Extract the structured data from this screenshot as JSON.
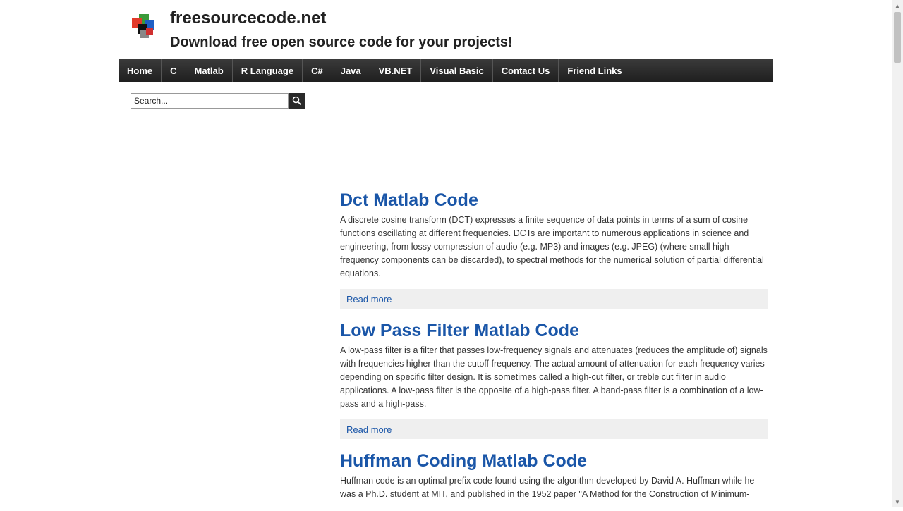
{
  "header": {
    "title": "freesourcecode.net",
    "tagline": "Download free open source code for your projects!"
  },
  "nav": {
    "items": [
      "Home",
      "C",
      "Matlab",
      "R Language",
      "C#",
      "Java",
      "VB.NET",
      "Visual Basic",
      "Contact Us",
      "Friend Links"
    ]
  },
  "search": {
    "value": "Search..."
  },
  "articles": [
    {
      "title": "Dct Matlab Code",
      "excerpt": "A discrete cosine transform (DCT) expresses a finite sequence of data points in terms of a sum of cosine functions oscillating at different frequencies. DCTs are important to numerous applications in science and engineering, from lossy compression of audio (e.g. MP3) and images (e.g. JPEG) (where small high-frequency components can be discarded), to spectral methods for the numerical solution of partial differential equations.",
      "read_more": "Read more"
    },
    {
      "title": "Low Pass Filter Matlab Code",
      "excerpt": "A low-pass filter is a filter that passes low-frequency signals and attenuates (reduces the amplitude of) signals with frequencies higher than the cutoff frequency. The actual amount of attenuation for each frequency varies depending on specific filter design. It is sometimes called a high-cut filter, or treble cut filter in audio applications. A low-pass filter is the opposite of a high-pass filter. A band-pass filter is a combination of a low-pass and a high-pass.",
      "read_more": "Read more"
    },
    {
      "title": "Huffman Coding Matlab Code",
      "excerpt": "Huffman code is an optimal prefix code found using the algorithm developed by David A. Huffman while he was a Ph.D. student at MIT, and published in the 1952 paper \"A Method for the Construction of Minimum-",
      "read_more": ""
    }
  ],
  "colors": {
    "link": "#1a56a8",
    "nav_bg": "#2a2a2a",
    "read_more_bg": "#efefef"
  }
}
